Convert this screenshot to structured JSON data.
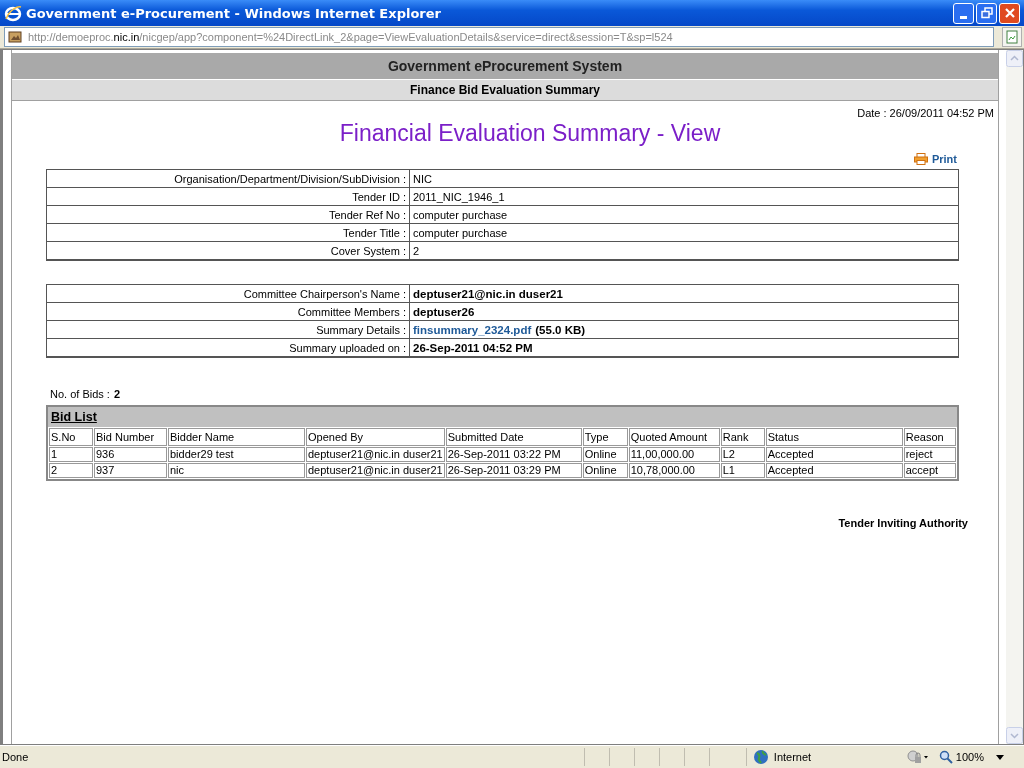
{
  "window": {
    "title": "Government e-Procurement - Windows Internet Explorer"
  },
  "address_bar": {
    "url_prefix": "http://demoeproc.",
    "url_host": "nic.in",
    "url_rest": "/nicgep/app?component=%24DirectLink_2&page=ViewEvaluationDetails&service=direct&session=T&sp=l524"
  },
  "page": {
    "header": "Government eProcurement System",
    "subheader": "Finance Bid Evaluation Summary",
    "date": "Date : 26/09/2011 04:52 PM",
    "heading": "Financial Evaluation Summary - View",
    "print_link": "Print",
    "tender_details": [
      {
        "label": "Organisation/Department/Division/SubDivision :",
        "value": "NIC"
      },
      {
        "label": "Tender ID :",
        "value": "2011_NIC_1946_1"
      },
      {
        "label": "Tender Ref No :",
        "value": "computer purchase"
      },
      {
        "label": "Tender Title :",
        "value": "computer purchase"
      },
      {
        "label": "Cover System :",
        "value": "2"
      }
    ],
    "committee": [
      {
        "kind": "text",
        "label": "Committee Chairperson's Name :",
        "value": "deptuser21@nic.in duser21"
      },
      {
        "kind": "text",
        "label": "Committee Members :",
        "value": "deptuser26"
      },
      {
        "kind": "file",
        "label": "Summary Details :",
        "link": "finsummary_2324.pdf",
        "size": "(**55.0 KB**)"
      },
      {
        "kind": "text",
        "label": "Summary uploaded on :",
        "value": "26-Sep-2011 04:52 PM"
      }
    ],
    "bids_count": {
      "label": "No. of Bids :",
      "value": "2"
    },
    "bid_list": {
      "title": "Bid List",
      "columns": [
        "S.No",
        "Bid Number",
        "Bidder Name",
        "Opened By",
        "Submitted Date",
        "Type",
        "Quoted Amount",
        "Rank",
        "Status",
        "Reason"
      ],
      "rows": [
        [
          "1",
          "936",
          "bidder29 test",
          "deptuser21@nic.in duser21",
          "26-Sep-2011 03:22 PM",
          "Online",
          "11,00,000.00",
          "L2",
          "Accepted",
          "reject"
        ],
        [
          "2",
          "937",
          "nic",
          "deptuser21@nic.in duser21",
          "26-Sep-2011 03:29 PM",
          "Online",
          "10,78,000.00",
          "L1",
          "Accepted",
          "accept"
        ]
      ]
    },
    "footer": "Tender Inviting Authority"
  },
  "status_bar": {
    "text": "Done",
    "zone": "Internet",
    "zoom": "100%"
  }
}
